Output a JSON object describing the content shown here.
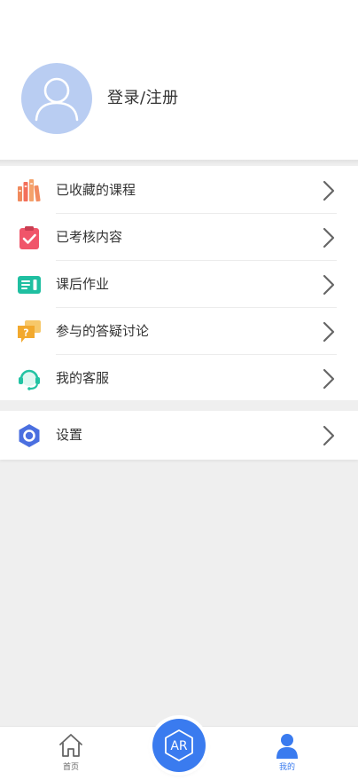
{
  "login": {
    "label": "登录/注册"
  },
  "menu": {
    "items": [
      {
        "label": "已收藏的课程",
        "icon": "books-icon"
      },
      {
        "label": "已考核内容",
        "icon": "clipboard-check-icon"
      },
      {
        "label": "课后作业",
        "icon": "homework-icon"
      },
      {
        "label": "参与的答疑讨论",
        "icon": "question-chat-icon"
      },
      {
        "label": "我的客服",
        "icon": "headset-icon"
      }
    ]
  },
  "settings": {
    "label": "设置",
    "icon": "settings-hexagon-icon"
  },
  "tabbar": {
    "home_label": "首页",
    "ar_label": "AR",
    "mine_label": "我的"
  },
  "colors": {
    "accent": "#3a7bef",
    "avatar_bg": "#b9cdf2",
    "page_bg": "#efefef"
  }
}
